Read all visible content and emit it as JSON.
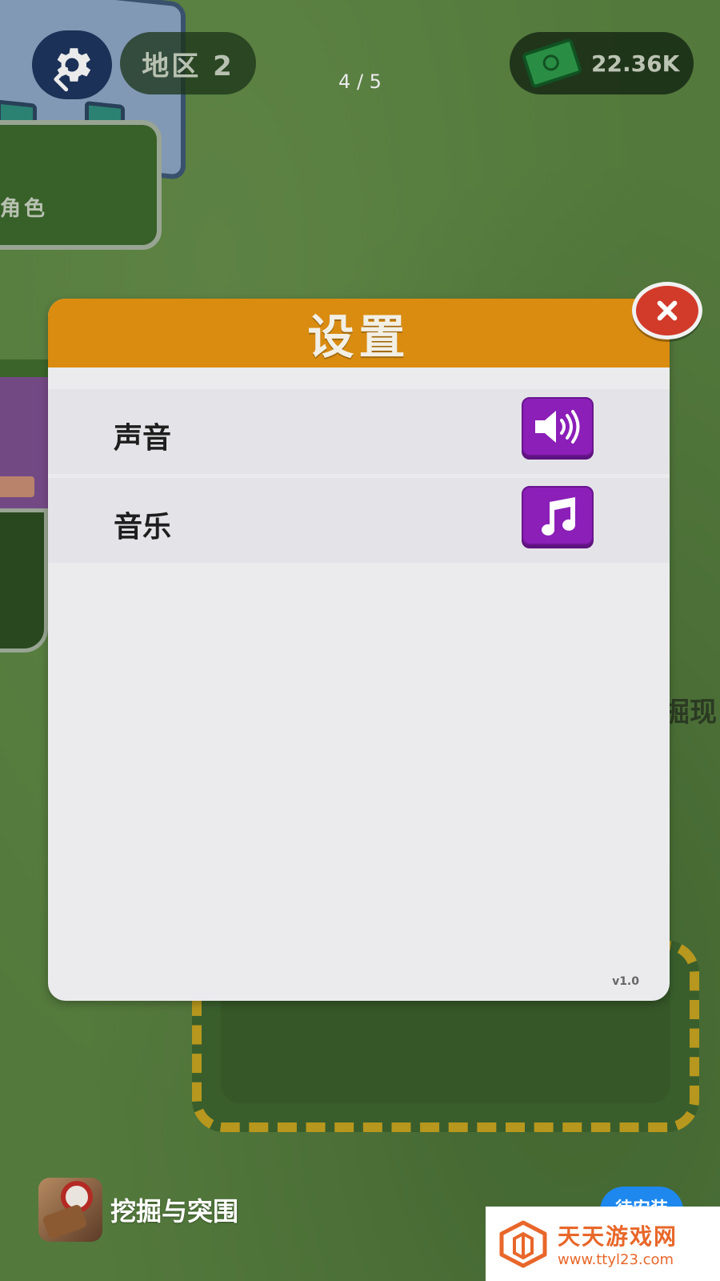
{
  "hud": {
    "region_label": "地区 2",
    "money_value": "22.36K",
    "page_indicator": "4 / 5"
  },
  "background": {
    "building_label": "角色",
    "side_text": "掘现"
  },
  "dialog": {
    "title": "设置",
    "rows": [
      {
        "label": "声音",
        "icon": "speaker-icon"
      },
      {
        "label": "音乐",
        "icon": "music-note-icon"
      }
    ],
    "version": "v1.0"
  },
  "ad_bar": {
    "app_name": "挖掘与突围",
    "install_label": "待安装"
  },
  "watermark": {
    "title": "天天游戏网",
    "url": "www.ttyl23.com"
  },
  "colors": {
    "header_orange": "#d98c10",
    "toggle_purple": "#8b1fb8",
    "close_red": "#d23a2a",
    "grass_green": "#5b8442"
  }
}
